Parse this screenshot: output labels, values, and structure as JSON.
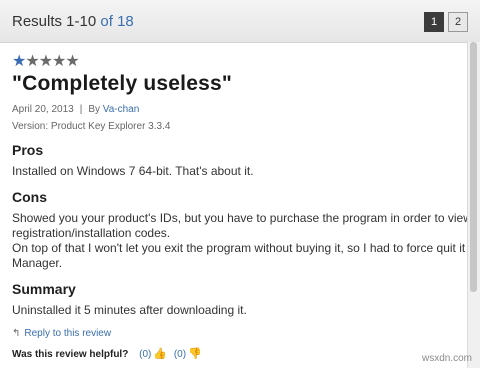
{
  "header": {
    "results_label": "Results 1-10",
    "of_label": "of 18",
    "pages": [
      "1",
      "2"
    ],
    "active_page": "1"
  },
  "review": {
    "rating": 1,
    "max_rating": 5,
    "title": "\"Completely useless\"",
    "date": "April 20, 2013",
    "separator": "|",
    "by_label": "By",
    "author": "Va-chan",
    "version": "Version: Product Key Explorer 3.3.4",
    "pros_heading": "Pros",
    "pros_text": "Installed on Windows 7 64-bit. That's about it.",
    "cons_heading": "Cons",
    "cons_line1": "Showed you your product's IDs, but you have to purchase the program in order to view yo",
    "cons_line2": "registration/installation codes.",
    "cons_line3": "On top of that I won't let you exit the program without buying it, so I had to force quit it usin",
    "cons_line4": "Manager.",
    "summary_heading": "Summary",
    "summary_text": "Uninstalled it 5 minutes after downloading it.",
    "reply_label": "Reply to this review",
    "helpful_label": "Was this review helpful?",
    "helpful_yes": "(0)",
    "helpful_no": "(0)"
  },
  "watermark": "wsxdn.com",
  "colors": {
    "accent": "#3a6fb0",
    "star_on": "#3b6cb3",
    "star_off": "#6a6a6a"
  }
}
